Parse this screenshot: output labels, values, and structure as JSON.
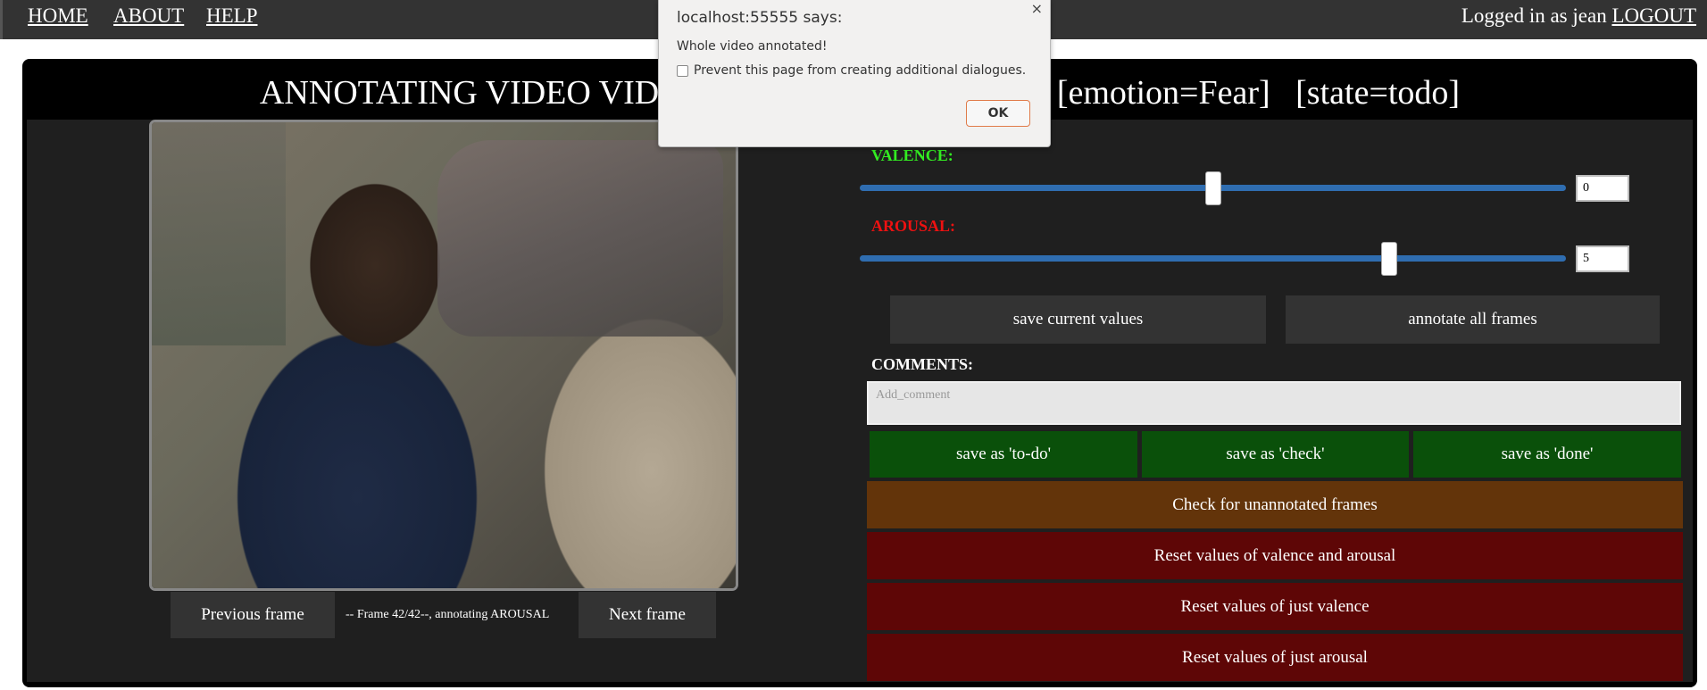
{
  "nav": {
    "home": "HOME",
    "about": "ABOUT",
    "help": "HELP",
    "logged_in_text": "Logged in as jean",
    "logout": "LOGOUT"
  },
  "panel": {
    "title": "ANNOTATING VIDEO VIDEO",
    "emotion_tag": "[emotion=Fear]",
    "state_tag": "[state=todo]"
  },
  "video": {
    "prev_button": "Previous frame",
    "frame_info": "-- Frame 42/42--, annotating AROUSAL",
    "next_button": "Next frame"
  },
  "valence": {
    "label": "VALENCE:",
    "value": "0",
    "slider_fraction": 0.5
  },
  "arousal": {
    "label": "AROUSAL:",
    "value": "5",
    "slider_fraction": 0.75
  },
  "actions": {
    "save_current": "save current values",
    "annotate_all": "annotate all frames"
  },
  "comments": {
    "label": "COMMENTS:",
    "placeholder": "Add_comment"
  },
  "state_buttons": {
    "todo": "save as 'to-do'",
    "check": "save as 'check'",
    "done": "save as 'done'"
  },
  "check_unannotated": "Check for unannotated frames",
  "reset": {
    "both": "Reset values of valence and arousal",
    "valence": "Reset values of just valence",
    "arousal": "Reset values of just arousal"
  },
  "dialog": {
    "title": "localhost:55555 says:",
    "close": "×",
    "message": "Whole video annotated!",
    "checkbox_label": "Prevent this page from creating additional dialogues.",
    "ok": "OK"
  },
  "colors": {
    "valence_label": "#33ee22",
    "arousal_label": "#ee1111",
    "slider_track": "#2f6db0",
    "green_button": "#0a500a",
    "orange_button": "#63340a",
    "red_button": "#5e0606"
  }
}
